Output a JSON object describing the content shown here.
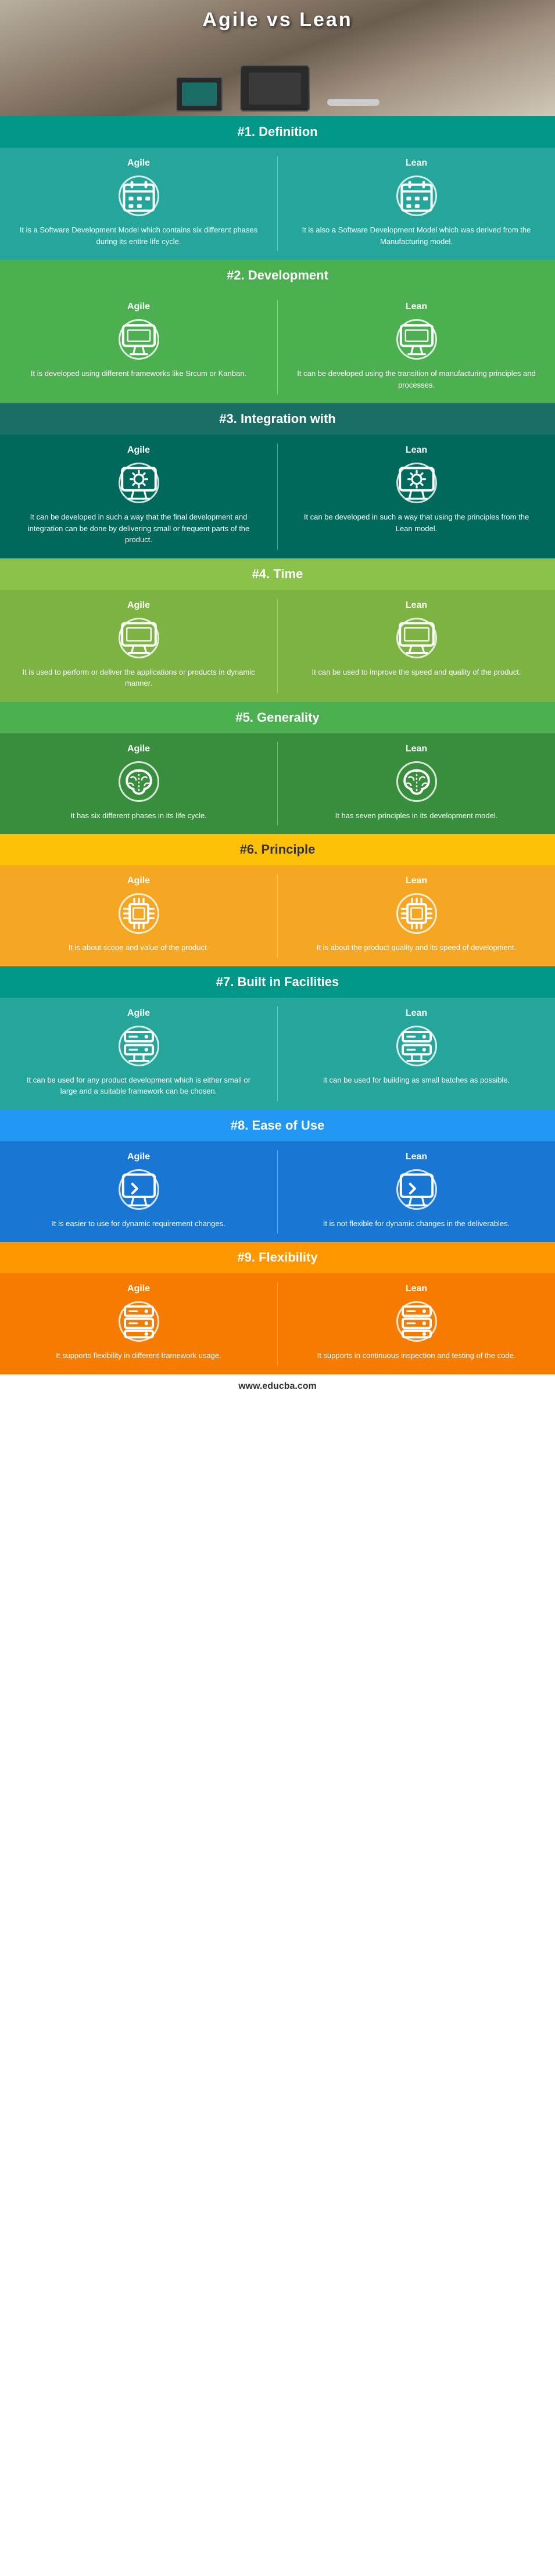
{
  "page": {
    "title": "Agile vs Lean",
    "footer": "www.educba.com"
  },
  "sections": [
    {
      "id": "definition",
      "number": "#1.",
      "label": "Definition",
      "bg_header": "teal",
      "bg_col": "bg-teal",
      "agile": {
        "label": "Agile",
        "text": "It is a Software Development Model which contains six different phases during its entire life cycle.",
        "icon": "calendar"
      },
      "lean": {
        "label": "Lean",
        "text": "It is also a Software Development Model which was derived from the Manufacturing model.",
        "icon": "calendar"
      }
    },
    {
      "id": "development",
      "number": "#2.",
      "label": "Development",
      "bg_header": "green",
      "bg_col": "bg-green",
      "agile": {
        "label": "Agile",
        "text": "It is developed using different frameworks like Srcum or Kanban.",
        "icon": "monitor"
      },
      "lean": {
        "label": "Lean",
        "text": "It can be developed using the transition of manufacturing principles and processes.",
        "icon": "monitor"
      }
    },
    {
      "id": "integration",
      "number": "#3.",
      "label": "Integration with",
      "bg_header": "dark-teal",
      "bg_col": "bg-dark-teal",
      "agile": {
        "label": "Agile",
        "text": "It can be developed in such a way that the final development and integration can be done by delivering small or frequent parts of the product.",
        "icon": "gear-screen"
      },
      "lean": {
        "label": "Lean",
        "text": "It can be developed in such a way that using the principles from the Lean model.",
        "icon": "gear-screen"
      }
    },
    {
      "id": "time",
      "number": "#4.",
      "label": "Time",
      "bg_header": "olive",
      "bg_col": "bg-olive",
      "agile": {
        "label": "Agile",
        "text": "It is used to perform or deliver the applications or products in dynamic manner.",
        "icon": "desktop"
      },
      "lean": {
        "label": "Lean",
        "text": "It can be used to improve the speed and quality of the product.",
        "icon": "desktop"
      }
    },
    {
      "id": "generality",
      "number": "#5.",
      "label": "Generality",
      "bg_header": "green",
      "bg_col": "bg-dark-green",
      "agile": {
        "label": "Agile",
        "text": "It has six different phases in its life cycle.",
        "icon": "brain"
      },
      "lean": {
        "label": "Lean",
        "text": "It has seven principles in its development model.",
        "icon": "brain"
      }
    },
    {
      "id": "principle",
      "number": "#6.",
      "label": "Principle",
      "bg_header": "amber",
      "bg_col": "bg-amber",
      "agile": {
        "label": "Agile",
        "text": "It is about scope and value of the product.",
        "icon": "chip"
      },
      "lean": {
        "label": "Lean",
        "text": "It is about the product quality and its speed of development.",
        "icon": "chip"
      }
    },
    {
      "id": "built-in-facilities",
      "number": "#7.",
      "label": "Built in Facilities",
      "bg_header": "teal",
      "bg_col": "bg-teal",
      "agile": {
        "label": "Agile",
        "text": "It can be used for any product development which is either small or large and a suitable framework can be chosen.",
        "icon": "server"
      },
      "lean": {
        "label": "Lean",
        "text": "It can be used for building as small batches as possible.",
        "icon": "server"
      }
    },
    {
      "id": "ease-of-use",
      "number": "#8.",
      "label": "Ease of Use",
      "bg_header": "blue",
      "bg_col": "bg-blue",
      "agile": {
        "label": "Agile",
        "text": "It is easier to use for dynamic requirement changes.",
        "icon": "monitor2"
      },
      "lean": {
        "label": "Lean",
        "text": "It is not flexible for dynamic changes in the deliverables.",
        "icon": "monitor2"
      }
    },
    {
      "id": "flexibility",
      "number": "#9.",
      "label": "Flexibility",
      "bg_header": "orange",
      "bg_col": "bg-orange",
      "agile": {
        "label": "Agile",
        "text": "It supports flexibility in different framework usage.",
        "icon": "server2"
      },
      "lean": {
        "label": "Lean",
        "text": "It supports in continuous inspection and testing of the code.",
        "icon": "server2"
      }
    }
  ]
}
